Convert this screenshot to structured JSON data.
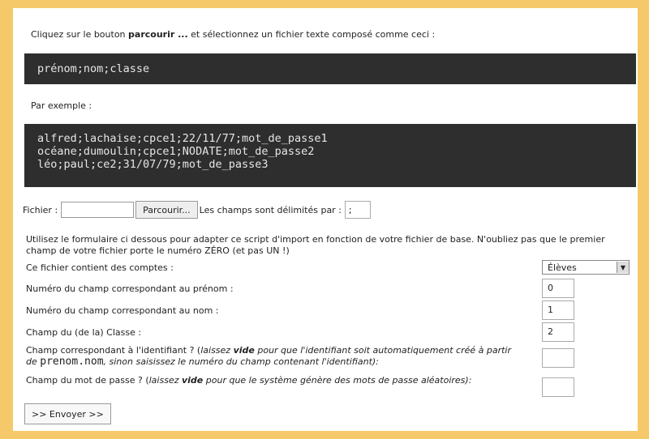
{
  "intro": {
    "prefix": "Cliquez sur le bouton ",
    "bold": "parcourir ...",
    "suffix": " et sélectionnez un fichier texte composé comme ceci :"
  },
  "format_line": "prénom;nom;classe",
  "example_label": "Par exemple :",
  "example_lines": [
    "alfred;lachaise;cpce1;22/11/77;mot_de_passe1",
    "océane;dumoulin;cpce1;NODATE;mot_de_passe2",
    "léo;paul;ce2;31/07/79;mot_de_passe3"
  ],
  "file": {
    "label": "Fichier :",
    "browse_button": "Parcourir...",
    "delimiter_label": "Les champs sont délimités par :",
    "delimiter_value": ";"
  },
  "help_text": "Utilisez le formulaire ci dessous pour adapter ce script d'import en fonction de votre fichier de base. N'oubliez pas que le premier champ de votre fichier porte le numéro ZÉRO (et pas UN !)",
  "fields": {
    "accounts_label": "Ce fichier contient des comptes :",
    "accounts_select": "Élèves",
    "prenom_label": "Numéro du champ correspondant au prénom :",
    "prenom_value": "0",
    "nom_label": "Numéro du champ correspondant au nom :",
    "nom_value": "1",
    "classe_label": "Champ du (de la) Classe :",
    "classe_value": "2",
    "id_label_a": "Champ correspondant à l'identifiant ? (",
    "id_label_b": "laissez ",
    "id_label_vide": "vide",
    "id_label_c": " pour que l'identifiant soit automatiquement créé à partir de ",
    "id_label_mono": "prenom.nom",
    "id_label_d": ", sinon saisissez le numéro du champ contenant l'identifiant):",
    "id_value": "",
    "pwd_label_a": "Champ du mot de passe ? (",
    "pwd_label_b": "laissez ",
    "pwd_label_vide": "vide",
    "pwd_label_c": " pour que le système génère des mots de passe aléatoires):",
    "pwd_value": ""
  },
  "submit_button": ">> Envoyer >>"
}
